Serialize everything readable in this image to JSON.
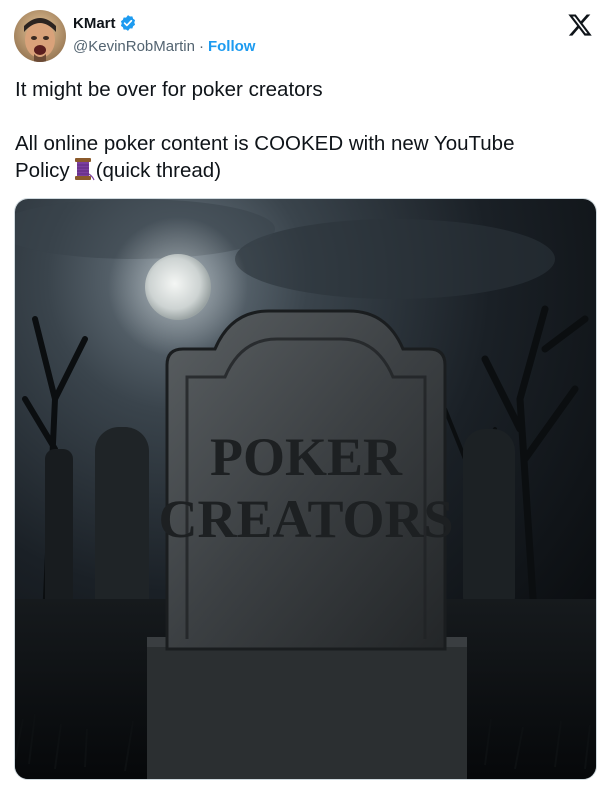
{
  "author": {
    "display_name": "KMart",
    "handle": "@KevinRobMartin",
    "separator": "·",
    "follow_label": "Follow",
    "verified": true
  },
  "tweet": {
    "line1": "It might be over for poker creators",
    "line2a": "All online poker content is COOKED with new YouTube",
    "line2b_pre": "Policy",
    "line2b_post": "(quick thread)"
  },
  "media": {
    "tombstone_line1": "POKER",
    "tombstone_line2": "CREATORS"
  },
  "icons": {
    "verified": "verified-badge-icon",
    "x_logo": "x-logo-icon",
    "thread_emoji": "spool-of-thread-icon"
  },
  "colors": {
    "accent": "#1d9bf0",
    "text": "#0f1419",
    "secondary": "#536471"
  }
}
